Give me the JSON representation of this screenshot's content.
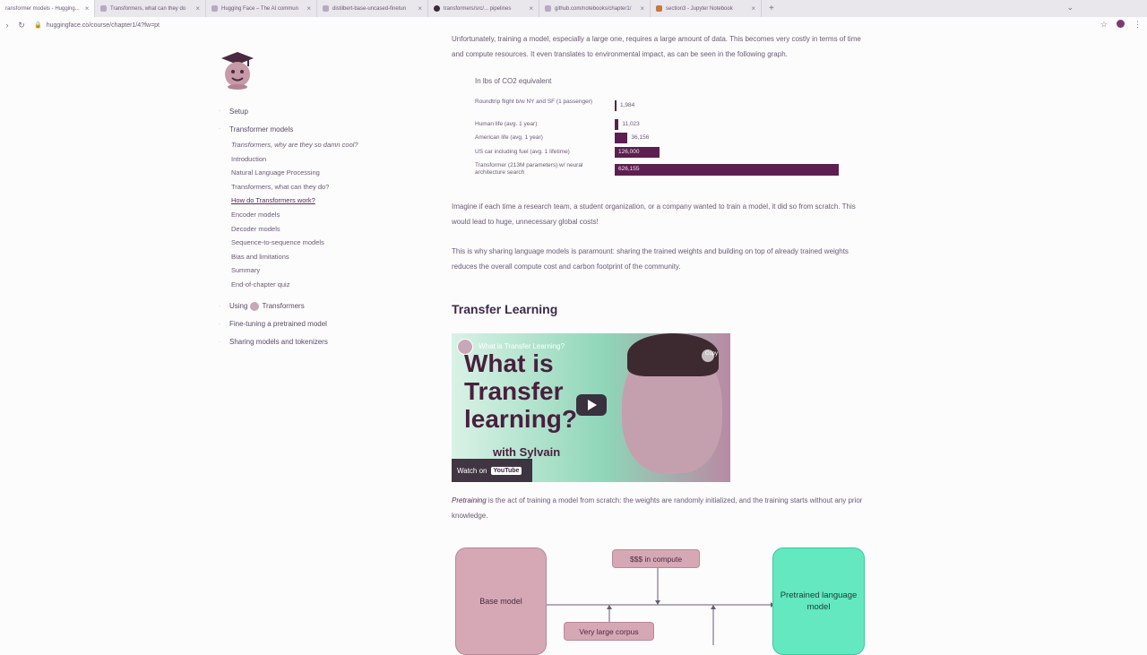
{
  "browser": {
    "tabs": [
      {
        "label": "ransformer models - Hugging..."
      },
      {
        "label": "Transformers, what can they do"
      },
      {
        "label": "Hugging Face – The AI commun"
      },
      {
        "label": "distilbert-base-uncased-finetun"
      },
      {
        "label": "transformers/src/... pipelines"
      },
      {
        "label": "github.com/notebooks/chapter1/"
      },
      {
        "label": "section3 - Jupyter Notebook"
      }
    ],
    "new_tab": "+",
    "url": "huggingface.co/course/chapter1/4?fw=pt"
  },
  "sidebar": {
    "sections": [
      {
        "label": "Setup"
      },
      {
        "label": "Transformer models"
      }
    ],
    "items": [
      {
        "label": "Transformers, why are they so damn cool?"
      },
      {
        "label": "Introduction"
      },
      {
        "label": "Natural Language Processing"
      },
      {
        "label": "Transformers, what can they do?"
      },
      {
        "label": "How do Transformers work?"
      },
      {
        "label": "Encoder models"
      },
      {
        "label": "Decoder models"
      },
      {
        "label": "Sequence-to-sequence models"
      },
      {
        "label": "Bias and limitations"
      },
      {
        "label": "Summary"
      },
      {
        "label": "End-of-chapter quiz"
      }
    ],
    "more_sections": [
      {
        "label_before": "Using",
        "label_after": "Transformers"
      },
      {
        "label": "Fine-tuning a pretrained model"
      },
      {
        "label": "Sharing models and tokenizers"
      }
    ]
  },
  "content": {
    "intro": "Unfortunately, training a model, especially a large one, requires a large amount of data. This becomes very costly in terms of time and compute resources. It even translates to environmental impact, as can be seen in the following graph.",
    "para2": "Imagine if each time a research team, a student organization, or a company wanted to train a model, it did so from scratch. This would lead to huge, unnecessary global costs!",
    "para3": "This is why sharing language models is paramount: sharing the trained weights and building on top of already trained weights reduces the overall compute cost and carbon footprint of the community.",
    "heading": "Transfer Learning",
    "pretraining_term": "Pretraining",
    "pretraining_rest": " is the act of training a model from scratch: the weights are randomly initialized, and the training starts without any prior knowledge."
  },
  "video": {
    "channel_title": "What is Transfer Learning?",
    "title_line1": "What is",
    "title_line2": "Transfer",
    "title_line3": "learning?",
    "with": "with Sylvain",
    "watch_on": "Watch on",
    "youtube": "YouTube",
    "share": "Copy"
  },
  "chart_data": {
    "type": "bar",
    "title": "In lbs of CO2 equivalent",
    "categories": [
      "Roundtrip flight b/w NY and SF (1 passenger)",
      "Human life (avg. 1 year)",
      "American life (avg. 1 year)",
      "US car including fuel (avg. 1 lifetime)",
      "Transformer (213M parameters) w/ neural architecture search"
    ],
    "values": [
      1984,
      11023,
      36156,
      126000,
      626155
    ],
    "value_labels": [
      "1,984",
      "11,023",
      "36,156",
      "126,000",
      "626,155"
    ],
    "orientation": "horizontal",
    "xlim": [
      0,
      626155
    ],
    "color": "#5c1f4f"
  },
  "diagram": {
    "base_model": "Base model",
    "compute": "$$$ in compute",
    "corpus": "Very large corpus",
    "pretrained": "Pretrained language model"
  }
}
